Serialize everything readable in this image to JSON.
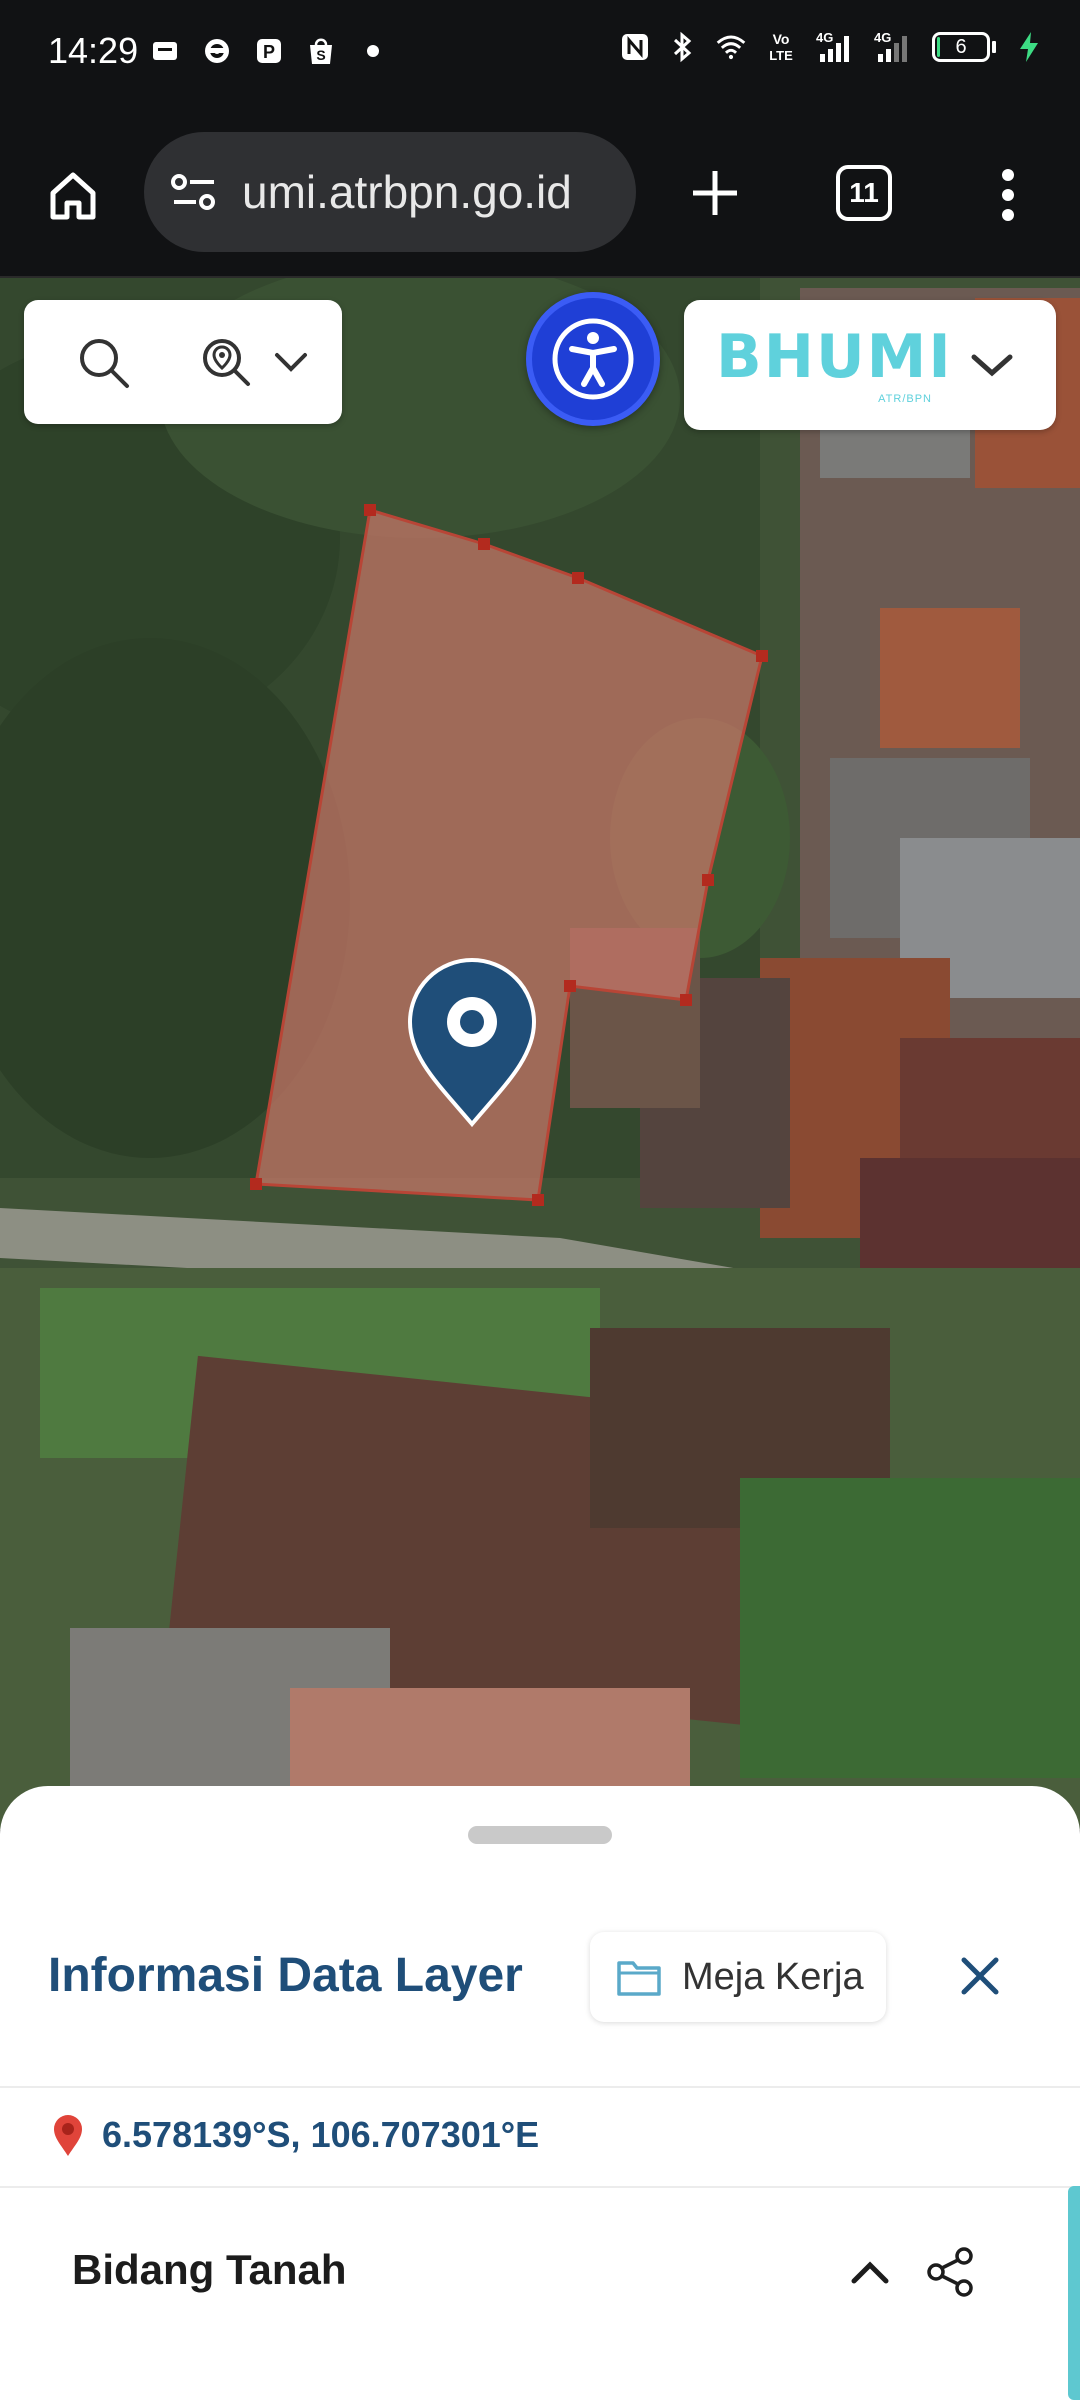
{
  "status_bar": {
    "time": "14:29",
    "notification_icons": [
      "message-icon",
      "steering-wheel-icon",
      "parking-icon",
      "shopee-icon",
      "dot-icon"
    ],
    "system_icons": [
      "nfc-icon",
      "bluetooth-icon",
      "wifi-icon",
      "volte-icon",
      "signal-4g-icon",
      "signal-4g-icon"
    ],
    "volte_label": "Vo\nLTE",
    "network_label_1": "4G",
    "network_label_2": "4G",
    "battery_level": "6",
    "battery_fraction": 0.06,
    "charging": true,
    "charging_color": "#3ddc84"
  },
  "browser": {
    "url": "umi.atrbpn.go.id",
    "tab_count": "11",
    "icons": [
      "home-icon",
      "tune-icon",
      "plus-icon",
      "more-vert-icon"
    ]
  },
  "map": {
    "brand_word": "BHUMI",
    "brand_sub": "ATR/BPN",
    "brand_color": "#5fd1dc",
    "accessibility_color": "#1f3fd6",
    "parcel_fill": "#c9776a",
    "parcel_stroke": "#b84536",
    "marker_color": "#1f4e79",
    "icons": [
      "search-icon",
      "locate-search-icon",
      "chevron-down-icon",
      "accessibility-icon",
      "map-marker-icon"
    ]
  },
  "panel": {
    "title": "Informasi Data Layer",
    "workspace_label": "Meja Kerja",
    "coordinates": "6.578139°S, 106.707301°E",
    "section_title": "Bidang Tanah",
    "accent_color": "#1f4e79",
    "scroll_color": "#5ec8d0",
    "icons": [
      "folder-icon",
      "close-icon",
      "pin-icon",
      "chevron-up-icon",
      "share-icon"
    ]
  }
}
